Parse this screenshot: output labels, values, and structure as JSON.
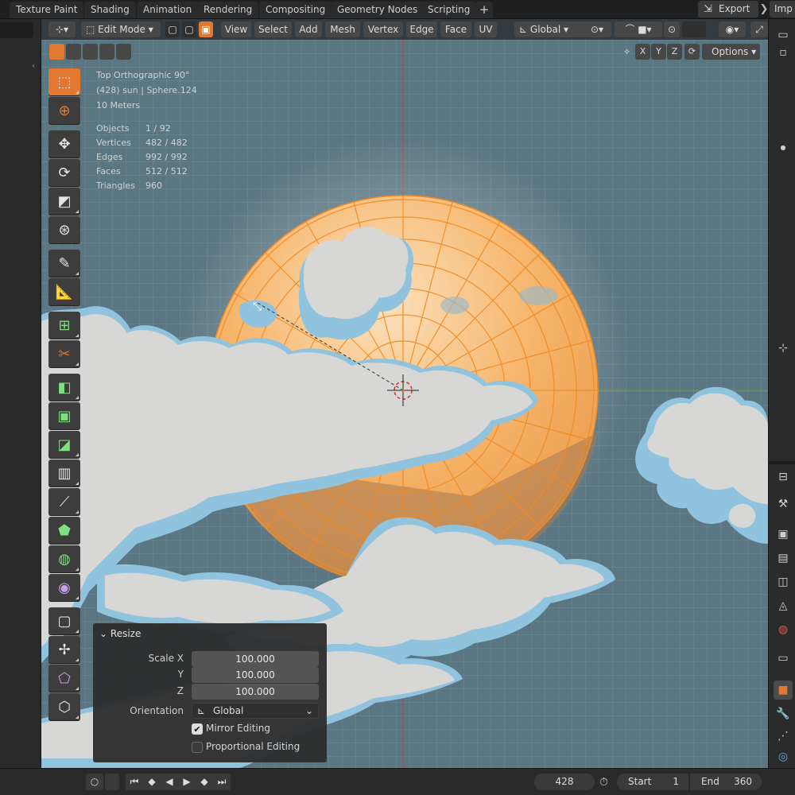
{
  "workspace_tabs": [
    "Texture Paint",
    "Shading",
    "Animation",
    "Rendering",
    "Compositing",
    "Geometry Nodes",
    "Scripting"
  ],
  "add_tab": "+",
  "export_label": "Export",
  "import_label": "Imp",
  "header": {
    "mode": "Edit Mode",
    "menus": [
      "View",
      "Select",
      "Add",
      "Mesh",
      "Vertex",
      "Edge",
      "Face",
      "UV"
    ],
    "orientation": "Global",
    "axes": [
      "X",
      "Y",
      "Z"
    ],
    "options_label": "Options"
  },
  "overlay": {
    "view": "Top Orthographic 90°",
    "object_line": "(428) sun | Sphere.124",
    "scale": "10 Meters",
    "stats": [
      {
        "label": "Objects",
        "value": "1 / 92"
      },
      {
        "label": "Vertices",
        "value": "482 / 482"
      },
      {
        "label": "Edges",
        "value": "992 / 992"
      },
      {
        "label": "Faces",
        "value": "512 / 512"
      },
      {
        "label": "Triangles",
        "value": "960"
      }
    ]
  },
  "resize_panel": {
    "title": "Resize",
    "scale_x_label": "Scale X",
    "y_label": "Y",
    "z_label": "Z",
    "scale_x": "100.000",
    "scale_y": "100.000",
    "scale_z": "100.000",
    "orientation_label": "Orientation",
    "orientation_value": "Global",
    "mirror_editing": "Mirror Editing",
    "mirror_checked": true,
    "proportional_editing": "Proportional Editing",
    "proportional_checked": false
  },
  "timeline": {
    "current_frame": "428",
    "start_label": "Start",
    "start": "1",
    "end_label": "End",
    "end": "360"
  },
  "colors": {
    "accent": "#e2772f",
    "viewport_bg": "#5a7682",
    "sun_orange": "#f6a54a",
    "cloud_white": "#d7d7d5",
    "cloud_blue": "#8fc3de"
  }
}
